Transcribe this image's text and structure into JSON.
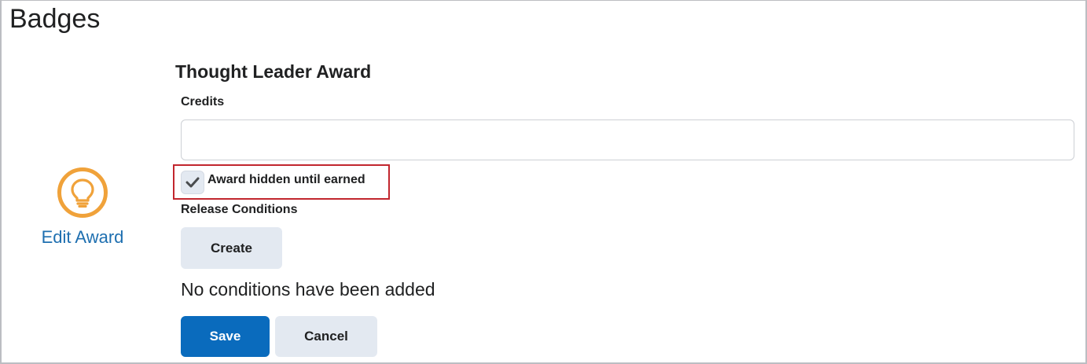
{
  "page": {
    "title": "Badges"
  },
  "award": {
    "name": "Thought Leader Award",
    "icon": "lightbulb-icon",
    "edit_label": "Edit Award",
    "icon_color": "#f0a23a"
  },
  "form": {
    "credits_label": "Credits",
    "credits_value": "",
    "credits_placeholder": "",
    "hidden_checkbox": {
      "label": "Award hidden until earned",
      "checked": true
    },
    "release_conditions_label": "Release Conditions",
    "create_button": "Create",
    "no_conditions_text": "No conditions have been added",
    "save_button": "Save",
    "cancel_button": "Cancel"
  },
  "colors": {
    "primary": "#0a6bbd",
    "link": "#1e6fb0",
    "secondary_button": "#e3e9f1",
    "highlight": "#c2262e"
  }
}
